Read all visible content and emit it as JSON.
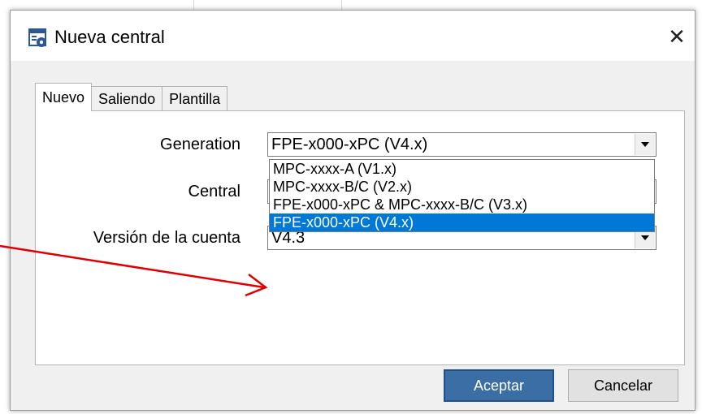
{
  "window": {
    "title": "Nueva central",
    "icon": "app-settings-icon",
    "close_glyph": "✕"
  },
  "tabs": [
    {
      "label": "Nuevo",
      "active": true
    },
    {
      "label": "Saliendo",
      "active": false
    },
    {
      "label": "Plantilla",
      "active": false
    }
  ],
  "form": {
    "generation": {
      "label": "Generation",
      "value": "FPE-x000-xPC (V4.x)"
    },
    "central": {
      "label": "Central",
      "value": ""
    },
    "version": {
      "label": "Versión de la cuenta",
      "value": "V4.3"
    }
  },
  "dropdown": {
    "options": [
      "MPC-xxxx-A (V1.x)",
      "MPC-xxxx-B/C (V2.x)",
      "FPE-x000-xPC & MPC-xxxx-B/C (V3.x)",
      "FPE-x000-xPC (V4.x)"
    ],
    "selected_index": 3
  },
  "buttons": {
    "accept": "Aceptar",
    "cancel": "Cancelar"
  },
  "colors": {
    "selection": "#0078d7",
    "primary_button": "#3a6ea5",
    "annotation_arrow": "#e00000"
  }
}
